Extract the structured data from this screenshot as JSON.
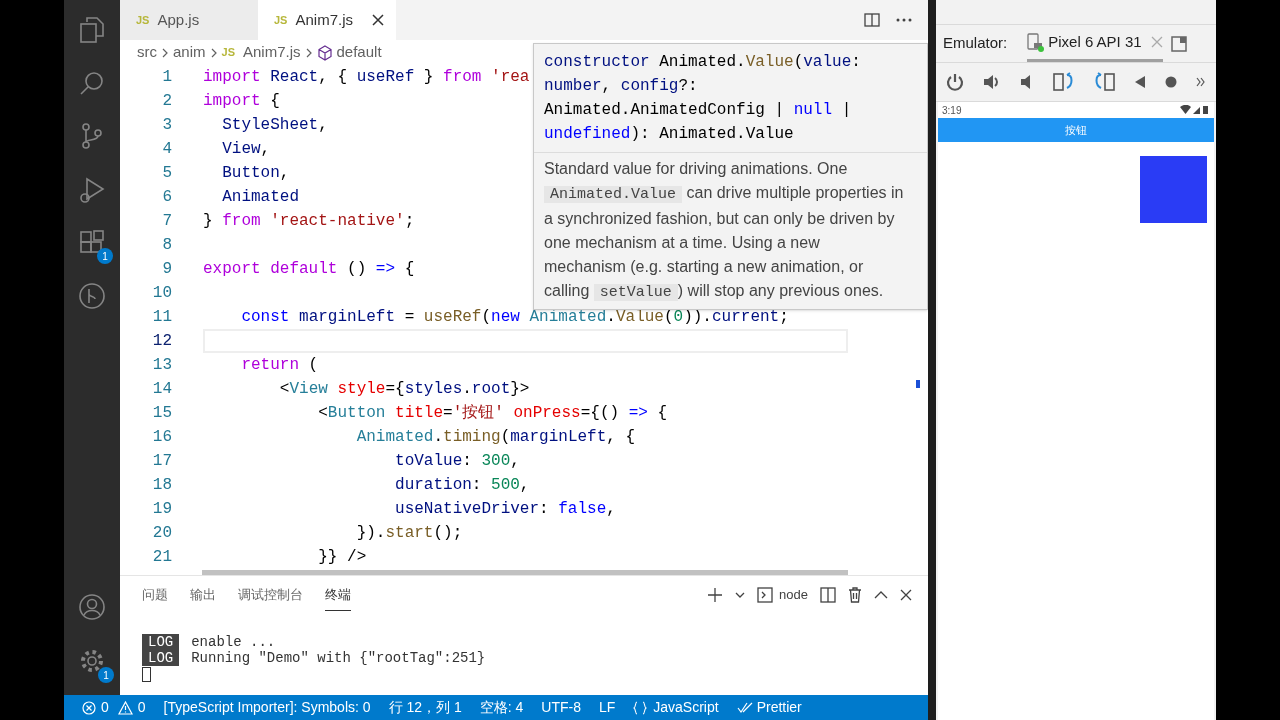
{
  "activity_bar": {
    "extensions_badge": "1",
    "settings_badge": "1"
  },
  "tabs": [
    {
      "file_type": "JS",
      "label": "App.js",
      "selected": false
    },
    {
      "file_type": "JS",
      "label": "Anim7.js",
      "selected": true
    }
  ],
  "breadcrumb": [
    {
      "label": "src"
    },
    {
      "label": "anim"
    },
    {
      "file_type": "JS",
      "label": "Anim7.js"
    },
    {
      "label": "default"
    }
  ],
  "editor": {
    "lines": [
      {
        "number": "1",
        "current": false,
        "tokens": [
          {
            "kind": "kw",
            "text": "import"
          },
          {
            "kind": "var",
            "text": " React"
          },
          {
            "kind": "p",
            "text": ", { "
          },
          {
            "kind": "var",
            "text": "useRef"
          },
          {
            "kind": "p",
            "text": " } "
          },
          {
            "kind": "kw",
            "text": "from"
          },
          {
            "kind": "str",
            "text": " 'rea"
          }
        ]
      },
      {
        "number": "2",
        "current": false,
        "tokens": [
          {
            "kind": "kw",
            "text": "import"
          },
          {
            "kind": "p",
            "text": " {"
          }
        ]
      },
      {
        "number": "3",
        "current": false,
        "tokens": [
          {
            "kind": "var",
            "text": "  StyleSheet"
          },
          {
            "kind": "p",
            "text": ","
          }
        ]
      },
      {
        "number": "4",
        "current": false,
        "tokens": [
          {
            "kind": "var",
            "text": "  View"
          },
          {
            "kind": "p",
            "text": ","
          }
        ]
      },
      {
        "number": "5",
        "current": false,
        "tokens": [
          {
            "kind": "var",
            "text": "  Button"
          },
          {
            "kind": "p",
            "text": ","
          }
        ]
      },
      {
        "number": "6",
        "current": false,
        "tokens": [
          {
            "kind": "var",
            "text": "  Animated"
          }
        ]
      },
      {
        "number": "7",
        "current": false,
        "tokens": [
          {
            "kind": "p",
            "text": "} "
          },
          {
            "kind": "kw",
            "text": "from"
          },
          {
            "kind": "str",
            "text": " 'react-native'"
          },
          {
            "kind": "p",
            "text": ";"
          }
        ]
      },
      {
        "number": "8",
        "current": false
      },
      {
        "number": "9",
        "current": false,
        "tokens": [
          {
            "kind": "kw",
            "text": "export"
          },
          {
            "kind": "kw",
            "text": " default"
          },
          {
            "kind": "p",
            "text": " () "
          },
          {
            "kind": "storage",
            "text": "=>"
          },
          {
            "kind": "p",
            "text": " {"
          }
        ]
      },
      {
        "number": "10",
        "current": false
      },
      {
        "number": "11",
        "current": false,
        "tokens": [
          {
            "kind": "storage",
            "text": "    const"
          },
          {
            "kind": "var",
            "text": " marginLeft"
          },
          {
            "kind": "p",
            "text": " = "
          },
          {
            "kind": "fn",
            "text": "useRef"
          },
          {
            "kind": "p",
            "text": "("
          },
          {
            "kind": "storage",
            "text": "new"
          },
          {
            "kind": "cls",
            "text": " Animated"
          },
          {
            "kind": "p",
            "text": "."
          },
          {
            "kind": "fn",
            "text": "Value"
          },
          {
            "kind": "p",
            "text": "("
          },
          {
            "kind": "num",
            "text": "0"
          },
          {
            "kind": "p",
            "text": "))."
          },
          {
            "kind": "var",
            "text": "current"
          },
          {
            "kind": "p",
            "text": ";"
          }
        ]
      },
      {
        "number": "12",
        "current": true
      },
      {
        "number": "13",
        "current": false,
        "tokens": [
          {
            "kind": "kw",
            "text": "    return"
          },
          {
            "kind": "p",
            "text": " ("
          }
        ]
      },
      {
        "number": "14",
        "current": false,
        "tokens": [
          {
            "kind": "p",
            "text": "        <"
          },
          {
            "kind": "cls",
            "text": "View"
          },
          {
            "kind": "attr",
            "text": " style"
          },
          {
            "kind": "p",
            "text": "={"
          },
          {
            "kind": "var",
            "text": "styles"
          },
          {
            "kind": "p",
            "text": "."
          },
          {
            "kind": "var",
            "text": "root"
          },
          {
            "kind": "p",
            "text": "}>"
          }
        ]
      },
      {
        "number": "15",
        "current": false,
        "tokens": [
          {
            "kind": "p",
            "text": "            <"
          },
          {
            "kind": "cls",
            "text": "Button"
          },
          {
            "kind": "attr",
            "text": " title"
          },
          {
            "kind": "p",
            "text": "="
          },
          {
            "kind": "str",
            "text": "'按钮'"
          },
          {
            "kind": "attr",
            "text": " onPress"
          },
          {
            "kind": "p",
            "text": "={() "
          },
          {
            "kind": "storage",
            "text": "=>"
          },
          {
            "kind": "p",
            "text": " {"
          }
        ]
      },
      {
        "number": "16",
        "current": false,
        "tokens": [
          {
            "kind": "cls",
            "text": "                Animated"
          },
          {
            "kind": "p",
            "text": "."
          },
          {
            "kind": "fn",
            "text": "timing"
          },
          {
            "kind": "p",
            "text": "("
          },
          {
            "kind": "var",
            "text": "marginLeft"
          },
          {
            "kind": "p",
            "text": ", {"
          }
        ]
      },
      {
        "number": "17",
        "current": false,
        "tokens": [
          {
            "kind": "var",
            "text": "                    toValue"
          },
          {
            "kind": "p",
            "text": ": "
          },
          {
            "kind": "num",
            "text": "300"
          },
          {
            "kind": "p",
            "text": ","
          }
        ]
      },
      {
        "number": "18",
        "current": false,
        "tokens": [
          {
            "kind": "var",
            "text": "                    duration"
          },
          {
            "kind": "p",
            "text": ": "
          },
          {
            "kind": "num",
            "text": "500"
          },
          {
            "kind": "p",
            "text": ","
          }
        ]
      },
      {
        "number": "19",
        "current": false,
        "tokens": [
          {
            "kind": "var",
            "text": "                    useNativeDriver"
          },
          {
            "kind": "p",
            "text": ": "
          },
          {
            "kind": "storage",
            "text": "false"
          },
          {
            "kind": "p",
            "text": ","
          }
        ]
      },
      {
        "number": "20",
        "current": false,
        "tokens": [
          {
            "kind": "p",
            "text": "                })."
          },
          {
            "kind": "fn",
            "text": "start"
          },
          {
            "kind": "p",
            "text": "();"
          }
        ]
      },
      {
        "number": "21",
        "current": false,
        "tokens": [
          {
            "kind": "p",
            "text": "            }} />"
          }
        ]
      }
    ]
  },
  "hover": {
    "signature": [
      [
        {
          "kind": "var",
          "text": "constructor"
        },
        {
          "kind": "p",
          "text": " Animated."
        },
        {
          "kind": "fn",
          "text": "Value"
        },
        {
          "kind": "p",
          "text": "("
        },
        {
          "kind": "var",
          "text": "value"
        },
        {
          "kind": "p",
          "text": ":"
        }
      ],
      [
        {
          "kind": "var",
          "text": "number"
        },
        {
          "kind": "p",
          "text": ", "
        },
        {
          "kind": "var",
          "text": "config"
        },
        {
          "kind": "p",
          "text": "?:"
        }
      ],
      [
        {
          "kind": "p",
          "text": "Animated.AnimatedConfig | "
        },
        {
          "kind": "storage",
          "text": "null"
        },
        {
          "kind": "p",
          "text": " |"
        }
      ],
      [
        {
          "kind": "storage",
          "text": "undefined"
        },
        {
          "kind": "p",
          "text": "): Animated.Value"
        }
      ]
    ],
    "description": [
      {
        "kind": "text",
        "text": "Standard value for driving animations. One "
      },
      {
        "kind": "code",
        "text": "Animated.Value"
      },
      {
        "kind": "text",
        "text": " can drive multiple properties in a synchronized fashion, but can only be driven by one mechanism at a time. Using a new mechanism (e.g. starting a new animation, or calling "
      },
      {
        "kind": "code",
        "text": "setValue"
      },
      {
        "kind": "text",
        "text": ") will stop any previous ones."
      }
    ]
  },
  "panel": {
    "tabs": [
      {
        "label": "问题",
        "selected": false
      },
      {
        "label": "输出",
        "selected": false
      },
      {
        "label": "调试控制台",
        "selected": false
      },
      {
        "label": "终端",
        "selected": true
      }
    ],
    "terminal_name": "node",
    "log": [
      {
        "badge": "LOG",
        "text": "enable ..."
      },
      {
        "badge": "LOG",
        "text": "Running \"Demo\" with {\"rootTag\":251}"
      }
    ]
  },
  "status_bar": {
    "items": [
      {
        "kind": "problems",
        "errors": "0",
        "warnings": "0"
      },
      {
        "kind": "text",
        "text": "[TypeScript Importer]: Symbols: 0"
      },
      {
        "kind": "text",
        "text": "行 12，列 1"
      },
      {
        "kind": "text",
        "text": "空格: 4"
      },
      {
        "kind": "text",
        "text": "UTF-8"
      },
      {
        "kind": "text",
        "text": "LF"
      },
      {
        "kind": "language",
        "text": "JavaScript"
      },
      {
        "kind": "formatter",
        "text": "Prettier"
      }
    ]
  },
  "emulator": {
    "label": "Emulator:",
    "device_tab": "Pixel 6 API 31",
    "phone": {
      "time": "3:19",
      "button": "按钮"
    }
  }
}
